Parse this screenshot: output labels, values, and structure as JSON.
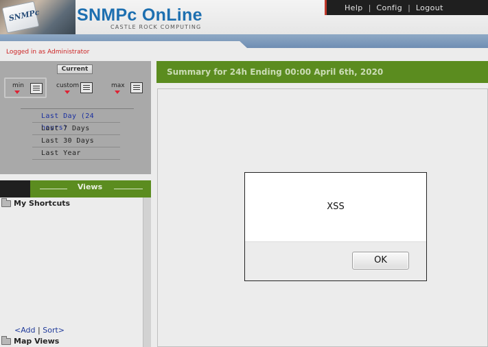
{
  "header": {
    "logo_text": "SNMPc",
    "title": "SNMPc OnLine",
    "subtitle": "CASTLE ROCK COMPUTING",
    "nav": {
      "help": "Help",
      "config": "Config",
      "logout": "Logout",
      "separator": "|"
    }
  },
  "session": {
    "login_status": "Logged in as Administrator"
  },
  "time_controls": {
    "current_label": "Current",
    "min_label": "min",
    "custom_label": "custom",
    "max_label": "max",
    "ranges": [
      {
        "label": "Last Day (24 hours)",
        "selected": true
      },
      {
        "label": "Last 7 Days",
        "selected": false
      },
      {
        "label": "Last 30 Days",
        "selected": false
      },
      {
        "label": "Last Year",
        "selected": false
      }
    ]
  },
  "views": {
    "title": "Views",
    "folders": {
      "shortcuts": "My Shortcuts",
      "map_views": "Map Views"
    },
    "add_link": "<Add",
    "link_separator": "|",
    "sort_link": "Sort>"
  },
  "main": {
    "summary_title": "Summary for 24h Ending 00:00 April 6th, 2020"
  },
  "alert": {
    "message": "XSS",
    "ok_label": "OK"
  },
  "colors": {
    "brand_blue": "#1d6fb0",
    "header_green": "#5b8c1f",
    "nav_dark": "#1f1f1f",
    "login_red": "#cc2222"
  }
}
